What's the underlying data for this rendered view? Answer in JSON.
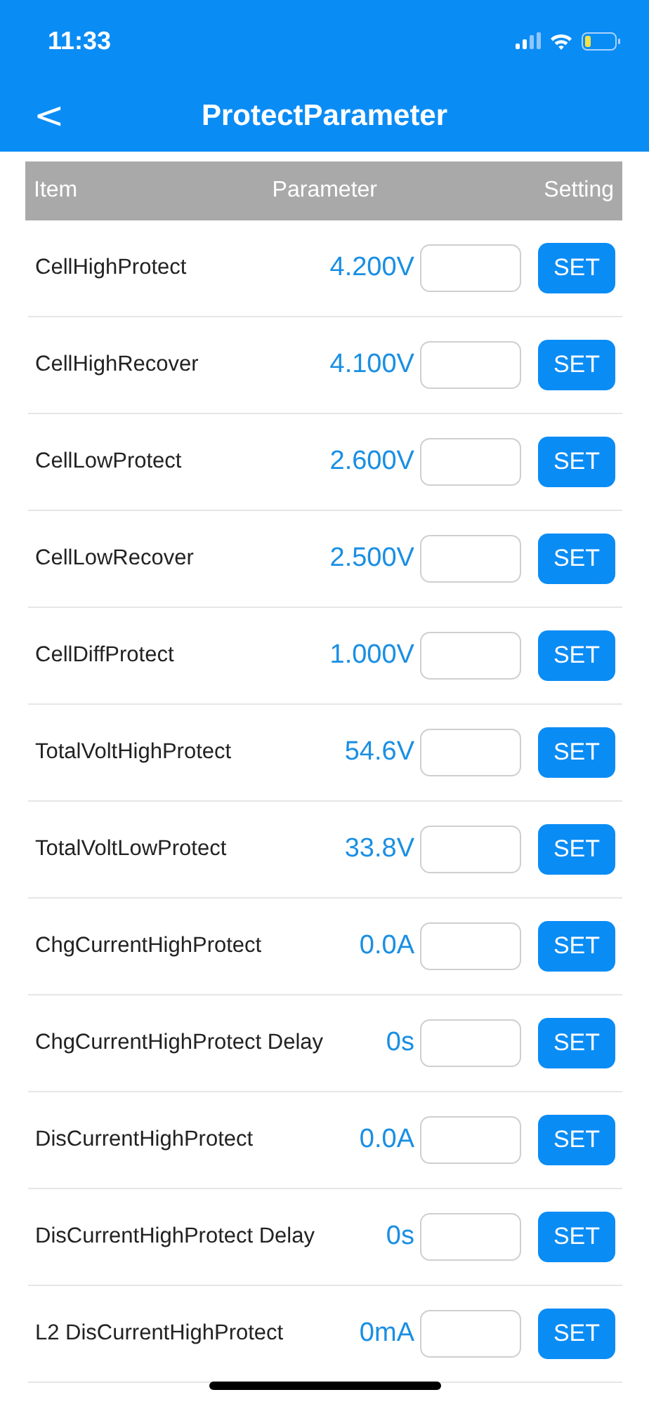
{
  "status_bar": {
    "time": "11:33"
  },
  "nav": {
    "back": "<",
    "title": "ProtectParameter"
  },
  "table": {
    "columns": [
      "Item",
      "Parameter",
      "Setting"
    ],
    "rows": [
      {
        "item": "CellHighProtect",
        "parameter": "4.200V",
        "button": "SET"
      },
      {
        "item": "CellHighRecover",
        "parameter": "4.100V",
        "button": "SET"
      },
      {
        "item": "CellLowProtect",
        "parameter": "2.600V",
        "button": "SET"
      },
      {
        "item": "CellLowRecover",
        "parameter": "2.500V",
        "button": "SET"
      },
      {
        "item": "CellDiffProtect",
        "parameter": "1.000V",
        "button": "SET"
      },
      {
        "item": "TotalVoltHighProtect",
        "parameter": "54.6V",
        "button": "SET"
      },
      {
        "item": "TotalVoltLowProtect",
        "parameter": "33.8V",
        "button": "SET"
      },
      {
        "item": "ChgCurrentHighProtect",
        "parameter": "0.0A",
        "button": "SET"
      },
      {
        "item": "ChgCurrentHighProtect Delay",
        "parameter": "0s",
        "button": "SET"
      },
      {
        "item": "DisCurrentHighProtect",
        "parameter": "0.0A",
        "button": "SET"
      },
      {
        "item": "DisCurrentHighProtect Delay",
        "parameter": "0s",
        "button": "SET"
      },
      {
        "item": "L2 DisCurrentHighProtect",
        "parameter": "0mA",
        "button": "SET"
      }
    ]
  }
}
